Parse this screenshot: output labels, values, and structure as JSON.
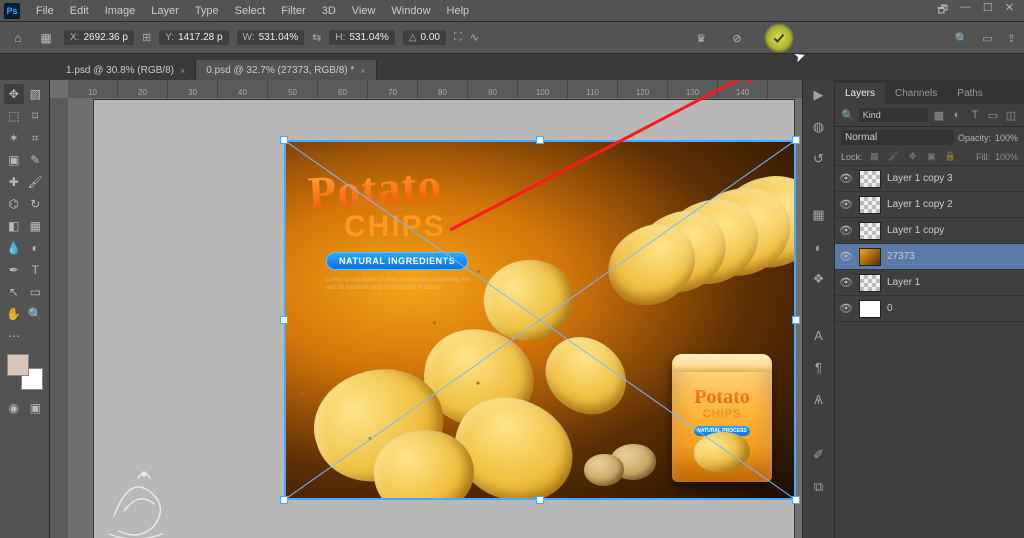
{
  "menu": [
    "File",
    "Edit",
    "Image",
    "Layer",
    "Type",
    "Select",
    "Filter",
    "3D",
    "View",
    "Window",
    "Help"
  ],
  "options": {
    "x_label": "X:",
    "x_val": "2692.36 p",
    "y_label": "Y:",
    "y_val": "1417.28 p",
    "w_label": "W:",
    "w_val": "531.04%",
    "h_label": "H:",
    "h_val": "531.04%",
    "ang_sym": "△",
    "ang_val": "0.00"
  },
  "tabs": [
    {
      "label": "1.psd @ 30.8% (RGB/8)",
      "active": false
    },
    {
      "label": "0.psd @ 32.7% (27373, RGB/8) *",
      "active": true
    }
  ],
  "ruler": [
    "10",
    "20",
    "30",
    "40",
    "50",
    "60",
    "70",
    "80",
    "90",
    "100",
    "110",
    "120",
    "130",
    "140"
  ],
  "artwork": {
    "title": "Potato",
    "subtitle": "CHIPS",
    "badge": "NATURAL INGREDIENTS",
    "lorem": "Lorem ipsum dolor sit amet consectetur adipiscing elit sed do eiusmod tempor incididunt ut labore.",
    "bag_brand": "Potato",
    "bag_sub": "CHIPS",
    "bag_badge": "NATURAL PROCESS"
  },
  "panel_tabs": [
    "Layers",
    "Channels",
    "Paths"
  ],
  "kind_label": "Kind",
  "blend": {
    "mode": "Normal",
    "opacity_label": "Opacity:",
    "opacity": "100%",
    "fill_label": "Fill:",
    "fill": "100%"
  },
  "lock_label": "Lock:",
  "layers": [
    {
      "name": "Layer 1 copy 3",
      "vis": true,
      "sel": false,
      "thumb": "checker"
    },
    {
      "name": "Layer 1 copy 2",
      "vis": true,
      "sel": false,
      "thumb": "checker"
    },
    {
      "name": "Layer 1 copy",
      "vis": true,
      "sel": false,
      "thumb": "checker"
    },
    {
      "name": "27373",
      "vis": true,
      "sel": true,
      "thumb": "img"
    },
    {
      "name": "Layer 1",
      "vis": true,
      "sel": false,
      "thumb": "checker"
    },
    {
      "name": "0",
      "vis": true,
      "sel": false,
      "thumb": "white"
    }
  ]
}
